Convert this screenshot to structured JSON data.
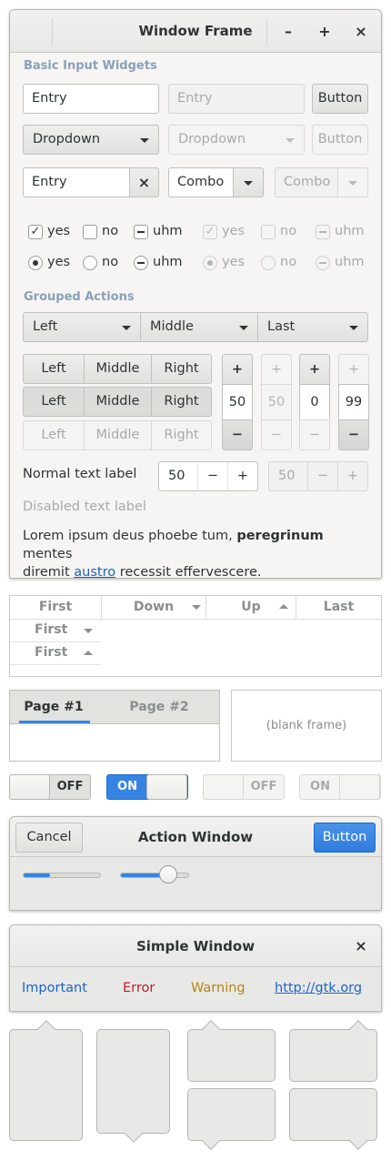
{
  "window": {
    "title": "Window Frame",
    "min_icon": "–",
    "max_icon": "+",
    "close_icon": "×"
  },
  "basic": {
    "section_label": "Basic Input Widgets",
    "entry_value": "Entry",
    "entry_disabled_placeholder": "Entry",
    "button_label": "Button",
    "button_disabled_label": "Button",
    "dropdown_label": "Dropdown",
    "dropdown_disabled_label": "Dropdown",
    "clear_entry_value": "Entry",
    "clear_icon": "×",
    "combo_value": "Combo",
    "combo_disabled_value": "Combo"
  },
  "checks": [
    {
      "label": "yes",
      "state": "checked"
    },
    {
      "label": "no",
      "state": "unchecked"
    },
    {
      "label": "uhm",
      "state": "mixed"
    }
  ],
  "radios": [
    {
      "label": "yes",
      "state": "checked"
    },
    {
      "label": "no",
      "state": "unchecked"
    },
    {
      "label": "uhm",
      "state": "mixed"
    }
  ],
  "grouped": {
    "section_label": "Grouped Actions",
    "combo_row": [
      "Left",
      "Middle",
      "Last"
    ],
    "segments": [
      "Left",
      "Middle",
      "Right"
    ],
    "spinners": [
      {
        "value": "50",
        "plus": "+",
        "minus": "−"
      },
      {
        "value": "50",
        "plus": "+",
        "minus": "−"
      },
      {
        "value": "0",
        "plus": "+",
        "minus": "−"
      },
      {
        "value": "99",
        "plus": "+",
        "minus": "−"
      }
    ]
  },
  "labels": {
    "normal": "Normal text label",
    "disabled": "Disabled text label",
    "spin_value": "50",
    "spin_disabled_value": "50",
    "minus": "−",
    "plus": "+",
    "lorem_a": "Lorem ipsum deus phoebe tum, ",
    "lorem_bold": "peregrinum",
    "lorem_b": " mentes",
    "lorem_c": "diremit ",
    "lorem_link": "austro",
    "lorem_d": " recessit effervescere."
  },
  "tree": {
    "headers": [
      "First",
      "Down",
      "Up",
      "Last"
    ],
    "rows": [
      "First",
      "First"
    ]
  },
  "notebook": {
    "tabs": [
      "Page #1",
      "Page #2"
    ],
    "blank_frame": "(blank frame)"
  },
  "switches": {
    "off": "OFF",
    "on": "ON"
  },
  "action_window": {
    "title": "Action Window",
    "cancel": "Cancel",
    "button": "Button",
    "slider1_value": 0.35,
    "slider2_value": 0.7
  },
  "simple_window": {
    "title": "Simple Window",
    "close_icon": "×",
    "important": "Important",
    "error": "Error",
    "warning": "Warning",
    "link": "http://gtk.org"
  },
  "colors": {
    "accent": "#3584e4",
    "link": "#1c64c8",
    "error": "#c01c28",
    "warning": "#b8860b",
    "section_label": "#8aa0b8"
  }
}
